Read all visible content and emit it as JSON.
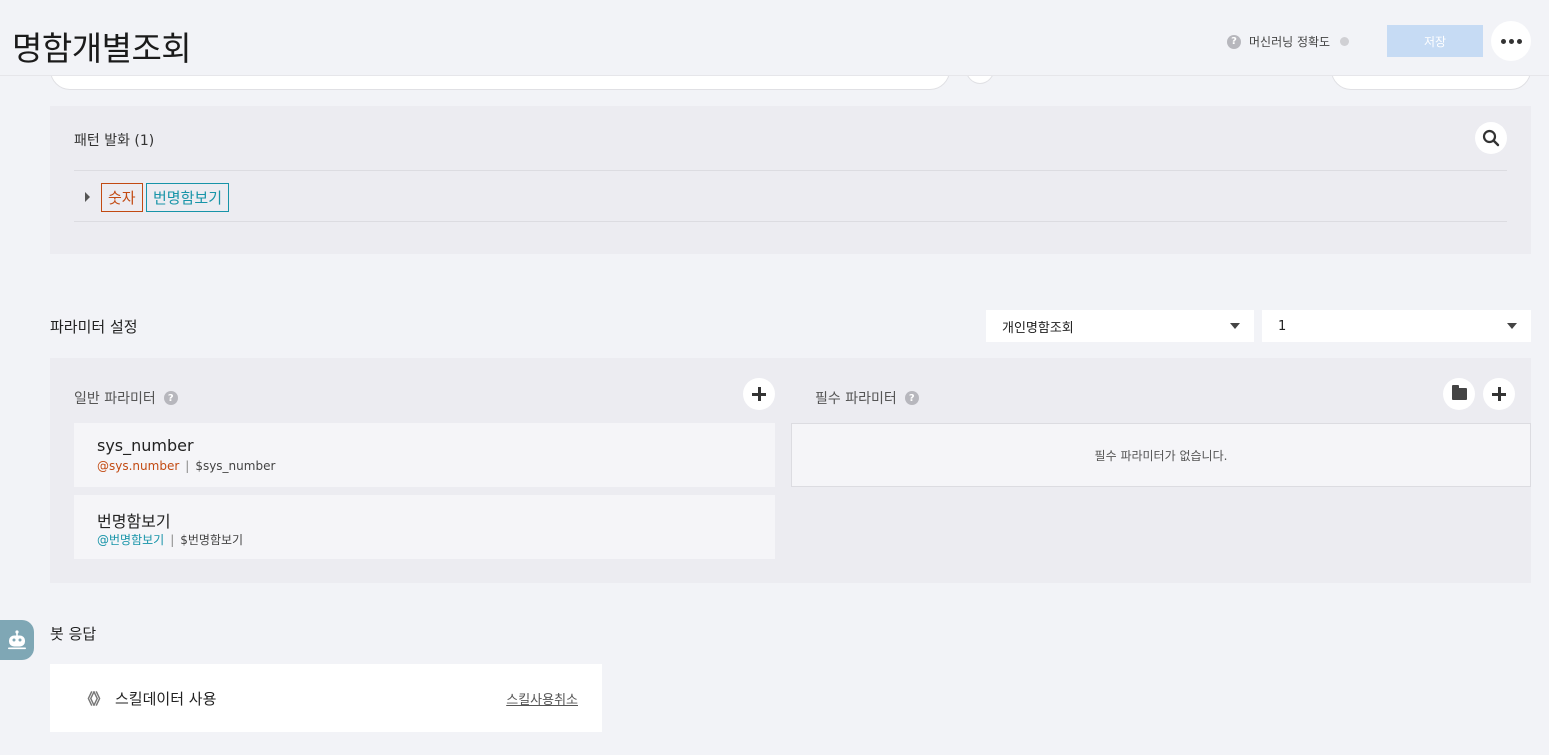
{
  "header": {
    "title": "명함개별조회",
    "ml_accuracy_label": "머신러닝 정확도",
    "help_glyph": "?",
    "save_label": "저장"
  },
  "pattern": {
    "title": "패턴 발화 (1)",
    "tags": [
      {
        "label": "숫자",
        "color": "#c24a12"
      },
      {
        "label": "번명함보기",
        "color": "#1794a8"
      }
    ]
  },
  "parameters": {
    "title": "파라미터 설정",
    "intent_select_value": "개인명함조회",
    "number_select_value": "1",
    "general": {
      "title": "일반 파라미터",
      "items": [
        {
          "name": "sys_number",
          "entity": "@sys.number",
          "variable": "$sys_number"
        },
        {
          "name": "번명함보기",
          "entity": "@번명함보기",
          "variable": "$번명함보기"
        }
      ]
    },
    "required": {
      "title": "필수 파라미터",
      "empty_text": "필수 파라미터가 없습니다."
    },
    "separator": "|"
  },
  "bot_response": {
    "title": "봇 응답",
    "skill_icon": "《》",
    "skill_label": "스킬데이터 사용",
    "cancel_label": "스킬사용취소"
  }
}
